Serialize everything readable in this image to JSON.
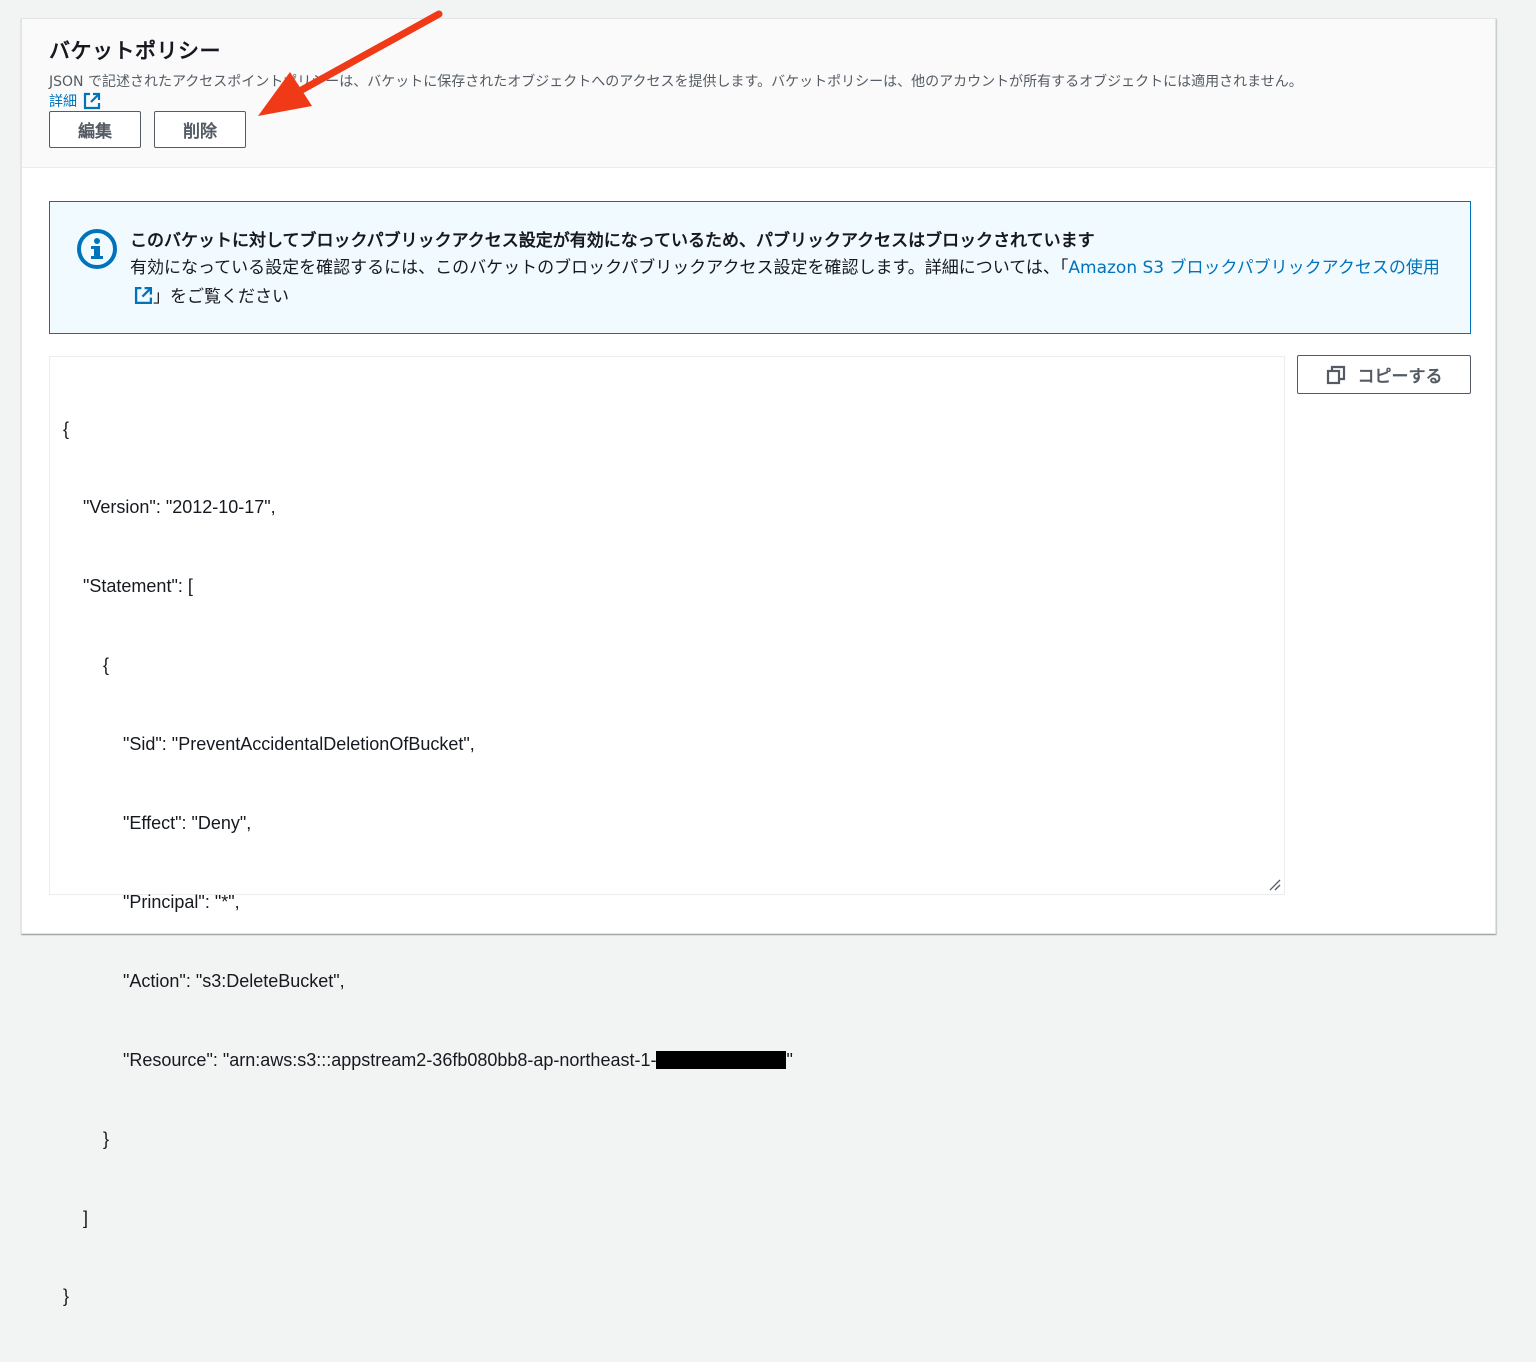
{
  "section": {
    "title": "バケットポリシー",
    "description": "JSON で記述されたアクセスポイントポリシーは、バケットに保存されたオブジェクトへのアクセスを提供します。バケットポリシーは、他のアカウントが所有するオブジェクトには適用されません。",
    "learn_more": "詳細",
    "edit_label": "編集",
    "delete_label": "削除"
  },
  "alert": {
    "title": "このバケットに対してブロックパブリックアクセス設定が有効になっているため、パブリックアクセスはブロックされています",
    "body_prefix": "有効になっている設定を確認するには、このバケットのブロックパブリックアクセス設定を確認します。詳細については、「",
    "link_text": "Amazon S3 ブロックパブリックアクセスの使用",
    "body_suffix": "」をご覧ください"
  },
  "policy": {
    "lines": [
      "{",
      "    \"Version\": \"2012-10-17\",",
      "    \"Statement\": [",
      "        {",
      "            \"Sid\": \"PreventAccidentalDeletionOfBucket\",",
      "            \"Effect\": \"Deny\",",
      "            \"Principal\": \"*\",",
      "            \"Action\": \"s3:DeleteBucket\",",
      "            \"Resource\": \"arn:aws:s3:::appstream2-36fb080bb8-ap-northeast-1-",
      "        }",
      "    ]",
      "}"
    ],
    "resource_suffix": "\""
  },
  "copy": {
    "label": "コピーする"
  },
  "colors": {
    "link": "#0073bb",
    "alert_bg": "#f1faff",
    "annotation_arrow": "#f03a17"
  }
}
